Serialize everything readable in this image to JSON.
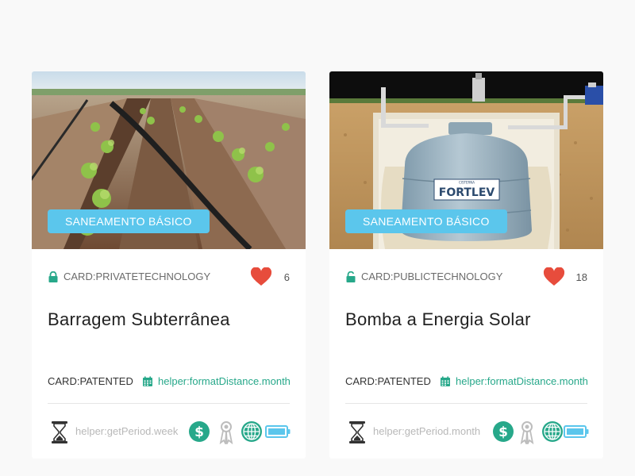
{
  "cards": [
    {
      "category": "SANEAMENTO BÁSICO",
      "technology_type": "CARD:PRIVATETECHNOLOGY",
      "likes": "6",
      "title": "Barragem Subterrânea",
      "patent_status": "CARD:PATENTED",
      "date_text": "helper:formatDistance.month",
      "period_text": "helper:getPeriod.week",
      "image_subject": "irrigation-field-photo",
      "tank_brand": ""
    },
    {
      "category": "SANEAMENTO BÁSICO",
      "technology_type": "CARD:PUBLICTECHNOLOGY",
      "likes": "18",
      "title": "Bomba a Energia Solar",
      "patent_status": "CARD:PATENTED",
      "date_text": "helper:formatDistance.month",
      "period_text": "helper:getPeriod.month",
      "image_subject": "underground-water-tank-illustration",
      "tank_brand": "FORTLEV",
      "tank_sub": "CISTERNA"
    }
  ],
  "colors": {
    "badge": "#5bc6ec",
    "accent_green": "#27a88a",
    "heart": "#e74c3c",
    "award_gray": "#bdbdbd",
    "background": "#f9f9f9"
  },
  "icons": {
    "lock_closed": "lock-icon",
    "lock_open": "unlock-icon",
    "like": "heart-icon",
    "date": "calendar-icon",
    "period": "hourglass-icon",
    "cost": "dollar-icon",
    "award": "award-ribbon-icon",
    "scope": "globe-icon",
    "energy": "battery-icon"
  }
}
